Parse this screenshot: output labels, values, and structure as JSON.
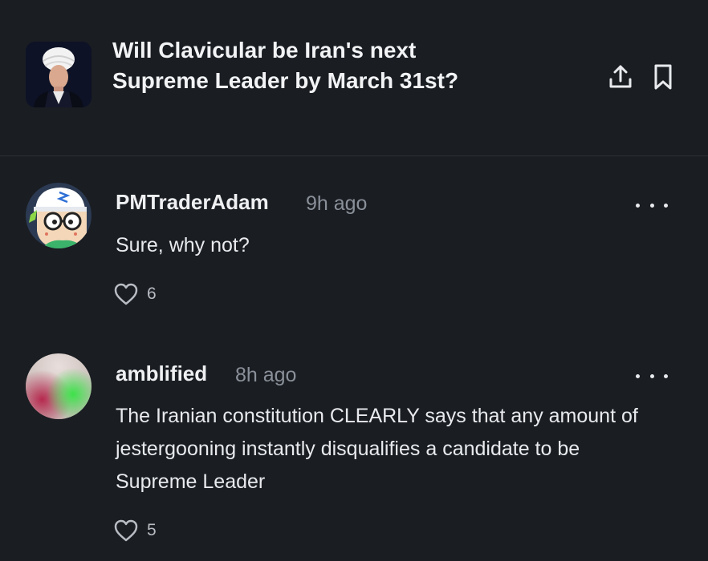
{
  "market": {
    "title": "Will Clavicular be Iran's next Supreme Leader by March 31st?",
    "thumbnail_icon": "cleric-portrait"
  },
  "header_actions": {
    "share_icon": "share-icon",
    "bookmark_icon": "bookmark-icon"
  },
  "comments": [
    {
      "username": "PMTraderAdam",
      "time": "9h ago",
      "text": "Sure, why not?",
      "likes": "6"
    },
    {
      "username": "amblified",
      "time": "8h ago",
      "text": "The Iranian constitution CLEARLY says that any amount of jestergooning instantly disqualifies a candidate to be Supreme Leader",
      "likes": "5"
    }
  ],
  "colors": {
    "background": "#1a1d22",
    "text_primary": "#e8eaed",
    "text_muted": "#8a9099",
    "divider": "#2c3036"
  }
}
